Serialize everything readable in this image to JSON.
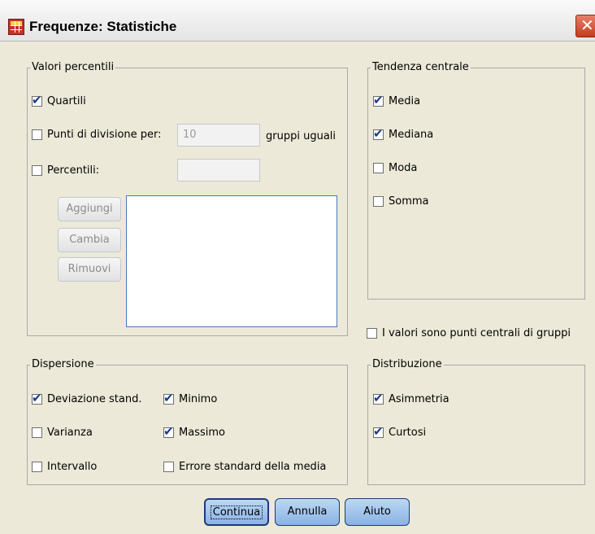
{
  "window": {
    "title": "Frequenze: Statistiche",
    "close_label": "✕"
  },
  "percentiles": {
    "legend": "Valori percentili",
    "quartiles": {
      "label": "Quartili",
      "checked": true
    },
    "cut_points": {
      "label": "Punti di divisione per:",
      "value": "10",
      "suffix": "gruppi uguali",
      "checked": false
    },
    "percentiles": {
      "label": "Percentili:",
      "value": "",
      "checked": false
    },
    "buttons": {
      "add": "Aggiungi",
      "change": "Cambia",
      "remove": "Rimuovi"
    }
  },
  "central_tendency": {
    "legend": "Tendenza centrale",
    "items": [
      {
        "label": "Media",
        "checked": true
      },
      {
        "label": "Mediana",
        "checked": true
      },
      {
        "label": "Moda",
        "checked": false
      },
      {
        "label": "Somma",
        "checked": false
      }
    ]
  },
  "group_midpoints": {
    "label": "I valori sono punti centrali di gruppi",
    "checked": false
  },
  "dispersion": {
    "legend": "Dispersione",
    "std_dev": {
      "label": "Deviazione stand.",
      "checked": true
    },
    "minimum": {
      "label": "Minimo",
      "checked": true
    },
    "variance": {
      "label": "Varianza",
      "checked": false
    },
    "maximum": {
      "label": "Massimo",
      "checked": true
    },
    "range": {
      "label": "Intervallo",
      "checked": false
    },
    "se_mean": {
      "label": "Errore standard della media",
      "checked": false
    }
  },
  "distribution": {
    "legend": "Distribuzione",
    "skewness": {
      "label": "Asimmetria",
      "checked": true
    },
    "kurtosis": {
      "label": "Curtosi",
      "checked": true
    }
  },
  "footer": {
    "continue": "Continua",
    "cancel": "Annulla",
    "help": "Aiuto"
  }
}
